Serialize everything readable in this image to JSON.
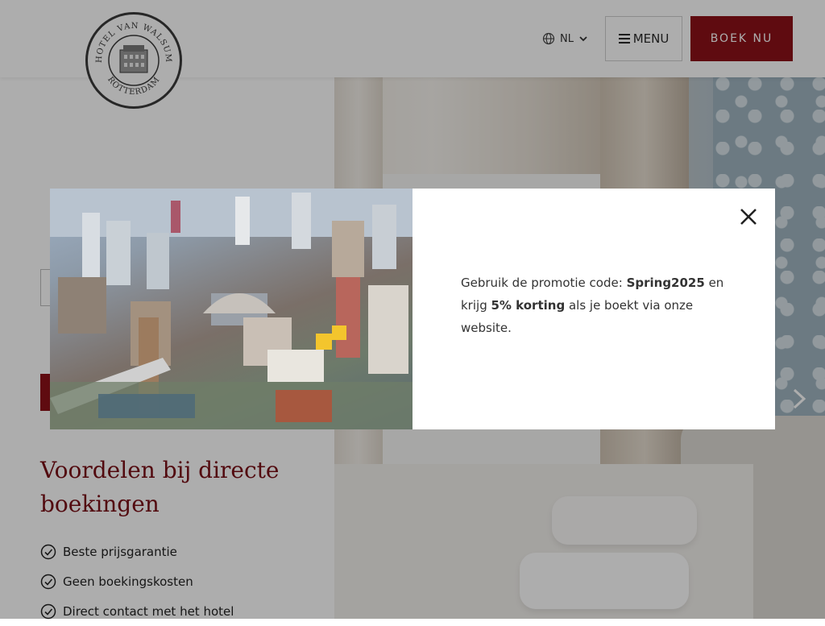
{
  "header": {
    "logo_text_top": "HOTEL VAN WALSUM",
    "logo_text_bottom": "ROTTERDAM",
    "language": "NL",
    "menu_label": "MENU",
    "book_label": "BOEK NU"
  },
  "left": {
    "benefits_title": "Voordelen bij directe boekingen",
    "benefits": [
      "Beste prijsgarantie",
      "Geen boekingskosten",
      "Direct contact met het hotel"
    ]
  },
  "modal": {
    "text_before_code": "Gebruik de promotie code: ",
    "promo_code": "Spring2025",
    "text_after_code": " en krijg ",
    "discount": "5% korting",
    "text_after_discount": " als je boekt via onze website."
  },
  "colors": {
    "brand": "#8c1119",
    "brand_dark": "#7a0f17",
    "overlay": "rgba(0,0,0,0.32)"
  },
  "icons": {
    "language": "globe-icon",
    "language_toggle": "chevron-down-icon",
    "menu": "hamburger-icon",
    "benefit": "check-circle-icon",
    "close": "close-icon",
    "slider_next": "chevron-right-icon"
  }
}
